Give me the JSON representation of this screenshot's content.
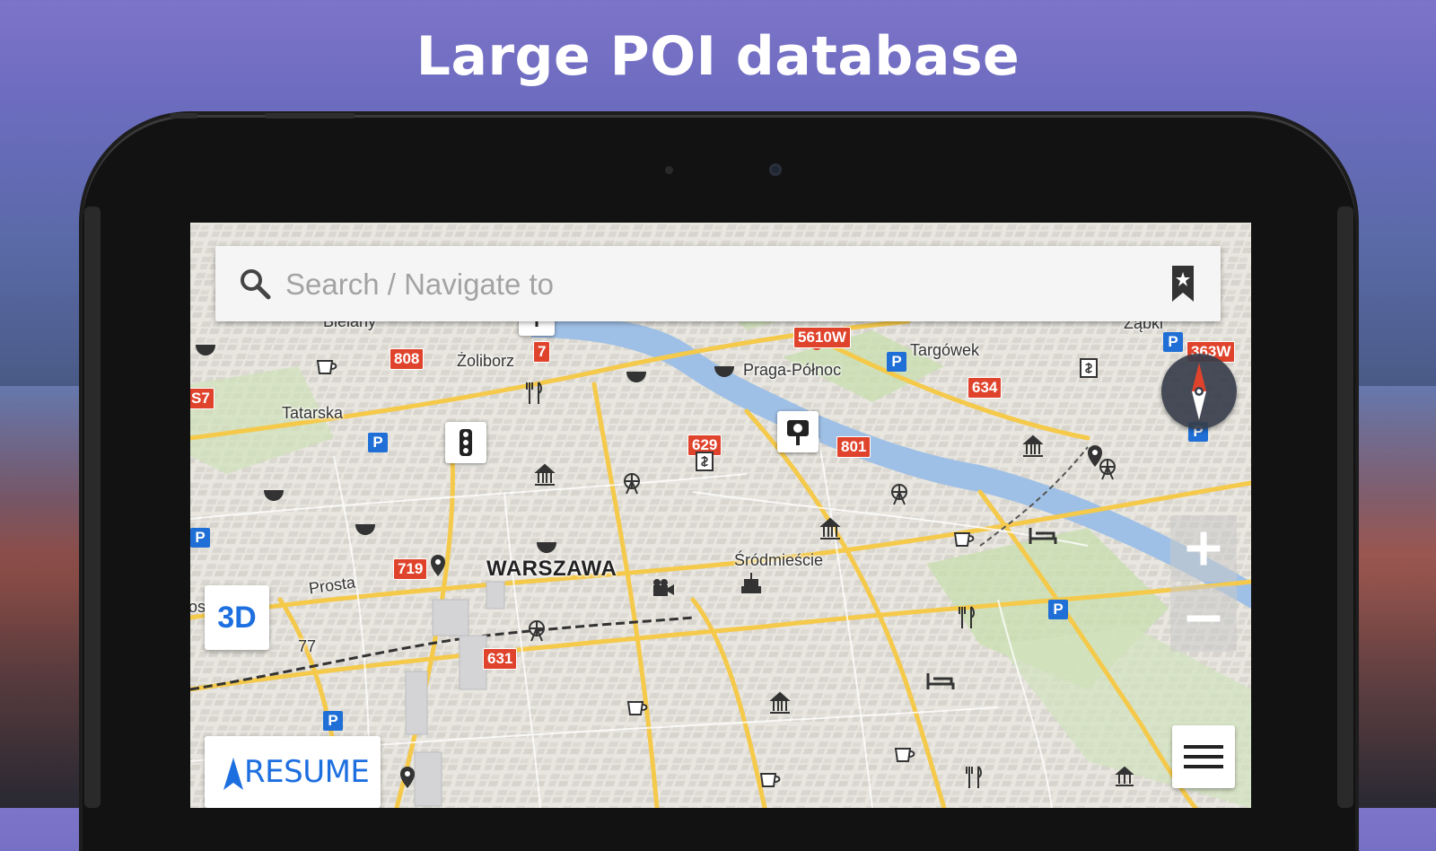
{
  "headline": "Large POI database",
  "search": {
    "placeholder": "Search / Navigate to"
  },
  "map": {
    "city_label": "WARSZAWA",
    "district_labels": [
      {
        "id": "bielany",
        "text": "Bielany"
      },
      {
        "id": "zoliborz",
        "text": "Żoliborz"
      },
      {
        "id": "tatarska",
        "text": "Tatarska"
      },
      {
        "id": "praga",
        "text": "Praga-Północ"
      },
      {
        "id": "targowek",
        "text": "Targówek"
      },
      {
        "id": "zabki",
        "text": "Ząbki"
      },
      {
        "id": "srodmiescie",
        "text": "Śródmieście"
      },
      {
        "id": "prosta",
        "text": "Prosta"
      },
      {
        "id": "num77",
        "text": "77"
      },
      {
        "id": "os",
        "text": "os"
      }
    ],
    "road_shields": [
      {
        "id": "r808",
        "text": "808"
      },
      {
        "id": "r7",
        "text": "7"
      },
      {
        "id": "r5610w",
        "text": "5610W"
      },
      {
        "id": "r634",
        "text": "634"
      },
      {
        "id": "r629",
        "text": "629"
      },
      {
        "id": "r801",
        "text": "801"
      },
      {
        "id": "r719",
        "text": "719"
      },
      {
        "id": "r631",
        "text": "631"
      },
      {
        "id": "rs7",
        "text": "S7"
      },
      {
        "id": "r363w",
        "text": "363W"
      }
    ],
    "parking_label": "P"
  },
  "controls": {
    "view_mode_label": "3D",
    "resume_label": "RESUME"
  },
  "colors": {
    "accent": "#1d6fe0",
    "road_shield": "#e0432c",
    "river": "#9fc0e6",
    "parking": "#1f6fd6"
  }
}
